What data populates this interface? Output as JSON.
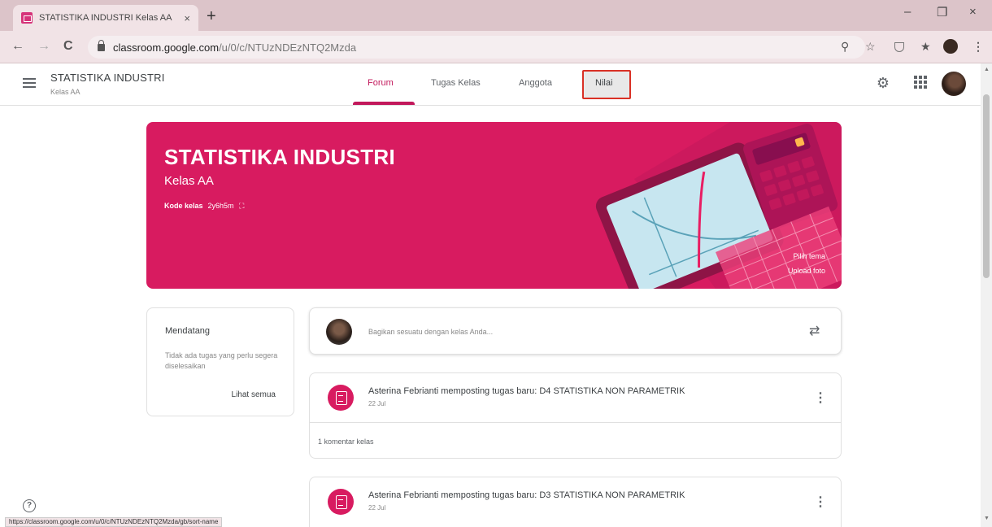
{
  "browser": {
    "tab_title": "STATISTIKA INDUSTRI Kelas AA",
    "tab_close": "×",
    "new_tab": "+",
    "url_host": "classroom.google.com",
    "url_path": "/u/0/c/NTUzNDEzNTQ2Mzda",
    "status_url": "https://classroom.google.com/u/0/c/NTUzNDEzNTQ2Mzda/gb/sort-name",
    "minimize": "–",
    "maximize": "❐",
    "close": "×"
  },
  "header": {
    "class_name": "STATISTIKA INDUSTRI",
    "class_section": "Kelas AA",
    "tabs": [
      {
        "label": "Forum"
      },
      {
        "label": "Tugas Kelas"
      },
      {
        "label": "Anggota"
      },
      {
        "label": "Nilai"
      }
    ],
    "active_tab": "Forum",
    "accent": "#c2185b"
  },
  "banner": {
    "title": "STATISTIKA INDUSTRI",
    "subtitle": "Kelas AA",
    "code_label": "Kode kelas",
    "code_value": "2y6h5m",
    "theme_link": "Pilih tema",
    "upload_link": "Upload foto",
    "color": "#d81b60"
  },
  "upcoming": {
    "title": "Mendatang",
    "empty_text": "Tidak ada tugas yang perlu segera diselesaikan",
    "view_all": "Lihat semua"
  },
  "share": {
    "placeholder": "Bagikan sesuatu dengan kelas Anda..."
  },
  "posts": [
    {
      "title": "Asterina Febrianti memposting tugas baru: D4 STATISTIKA NON PARAMETRIK",
      "date": "22 Jul",
      "comments": "1 komentar kelas"
    },
    {
      "title": "Asterina Febrianti memposting tugas baru: D3 STATISTIKA NON PARAMETRIK",
      "date": "22 Jul"
    }
  ],
  "icons": {
    "back": "←",
    "forward": "→",
    "reload": "C",
    "zoom": "⚲",
    "star": "☆",
    "extensions": "★",
    "more": "⋮",
    "gear": "⚙",
    "repost": "⇄",
    "post_more": "⋮",
    "help": "?"
  }
}
